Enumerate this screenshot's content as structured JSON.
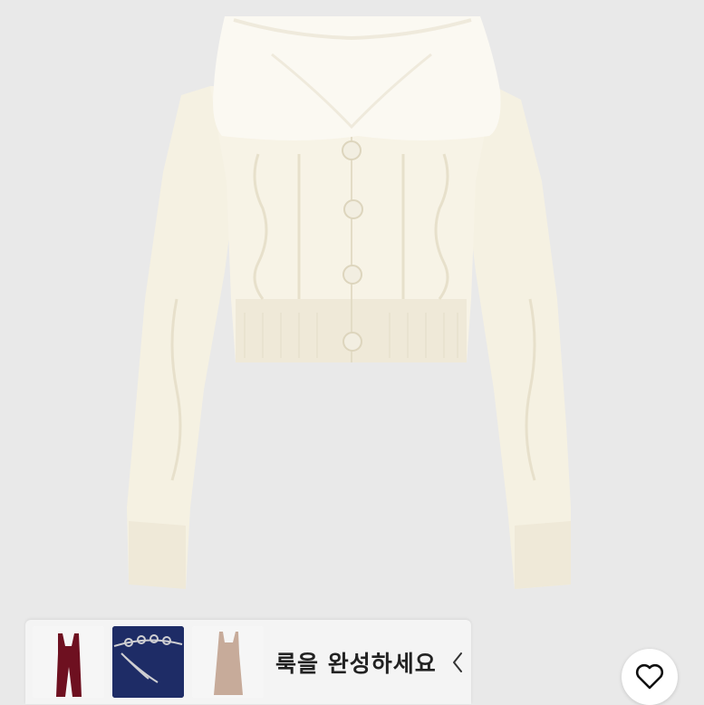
{
  "product": {
    "image_icon": "cream-cable-knit-cardigan-photo"
  },
  "look_bar": {
    "label": "룩을 완성하세요",
    "thumbnails": [
      {
        "icon": "burgundy-velvet-jumpsuit-thumb"
      },
      {
        "icon": "navy-velvet-skirt-chain-belt-thumb"
      },
      {
        "icon": "beige-knit-dress-thumb"
      }
    ],
    "chevron_icon": "chevron-left-icon"
  },
  "favorite": {
    "icon": "heart-icon"
  },
  "colors": {
    "background": "#e8e8e8",
    "garment": "#f7f3e6",
    "bar": "#f4f4f4"
  }
}
